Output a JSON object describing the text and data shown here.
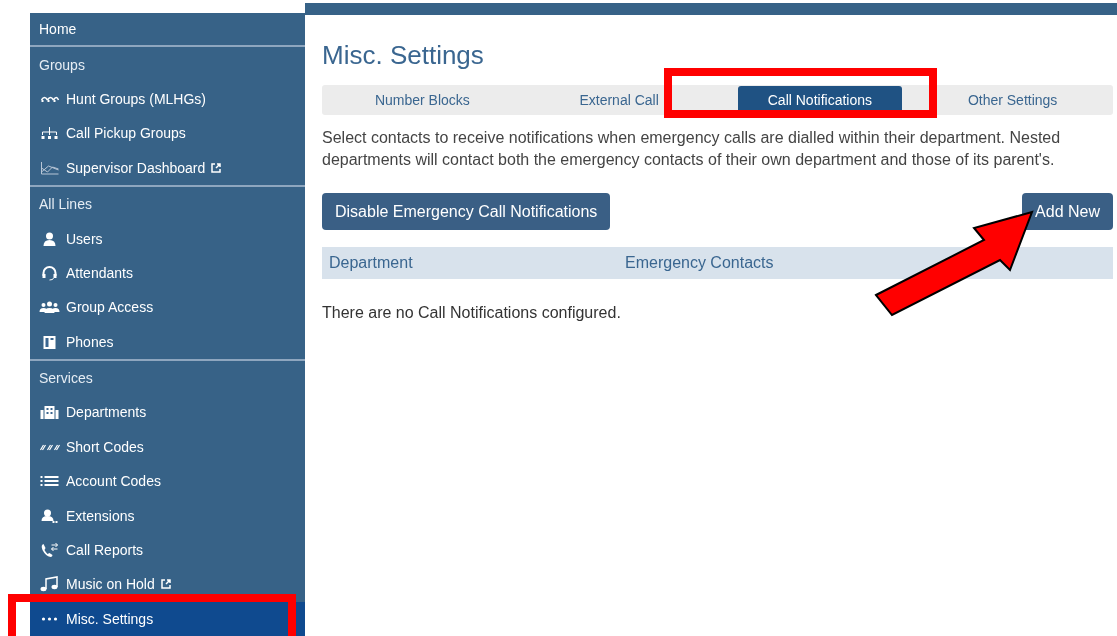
{
  "sidebar": {
    "home": "Home",
    "sections": [
      {
        "header": "Groups",
        "items": [
          {
            "label": "Hunt Groups (MLHGs)",
            "external": false,
            "selected": false
          },
          {
            "label": "Call Pickup Groups",
            "external": false,
            "selected": false
          },
          {
            "label": "Supervisor Dashboard",
            "external": true,
            "selected": false
          }
        ]
      },
      {
        "header": "All Lines",
        "items": [
          {
            "label": "Users",
            "external": false,
            "selected": false
          },
          {
            "label": "Attendants",
            "external": false,
            "selected": false
          },
          {
            "label": "Group Access",
            "external": false,
            "selected": false
          },
          {
            "label": "Phones",
            "external": false,
            "selected": false
          }
        ]
      },
      {
        "header": "Services",
        "items": [
          {
            "label": "Departments",
            "external": false,
            "selected": false
          },
          {
            "label": "Short Codes",
            "external": false,
            "selected": false
          },
          {
            "label": "Account Codes",
            "external": false,
            "selected": false
          },
          {
            "label": "Extensions",
            "external": false,
            "selected": false
          },
          {
            "label": "Call Reports",
            "external": false,
            "selected": false
          },
          {
            "label": "Music on Hold",
            "external": true,
            "selected": false
          },
          {
            "label": "Misc. Settings",
            "external": false,
            "selected": true
          }
        ]
      }
    ]
  },
  "page_title": "Misc. Settings",
  "tabs": [
    {
      "label": "Number Blocks",
      "selected": false
    },
    {
      "label": "External Call",
      "selected": false
    },
    {
      "label": "Call Notifications",
      "selected": true
    },
    {
      "label": "Other Settings",
      "selected": false
    }
  ],
  "description": "Select contacts to receive notifications when emergency calls are dialled within their department. Nested departments will contact both the emergency contacts of their own department and those of its parent's.",
  "buttons": {
    "disable": "Disable Emergency Call Notifications",
    "add": "Add New"
  },
  "table": {
    "columns": [
      "Department",
      "Emergency Contacts"
    ],
    "empty_message": "There are no Call Notifications configured."
  },
  "annotations": [
    {
      "kind": "box"
    },
    {
      "kind": "box"
    },
    {
      "kind": "arrow"
    }
  ]
}
